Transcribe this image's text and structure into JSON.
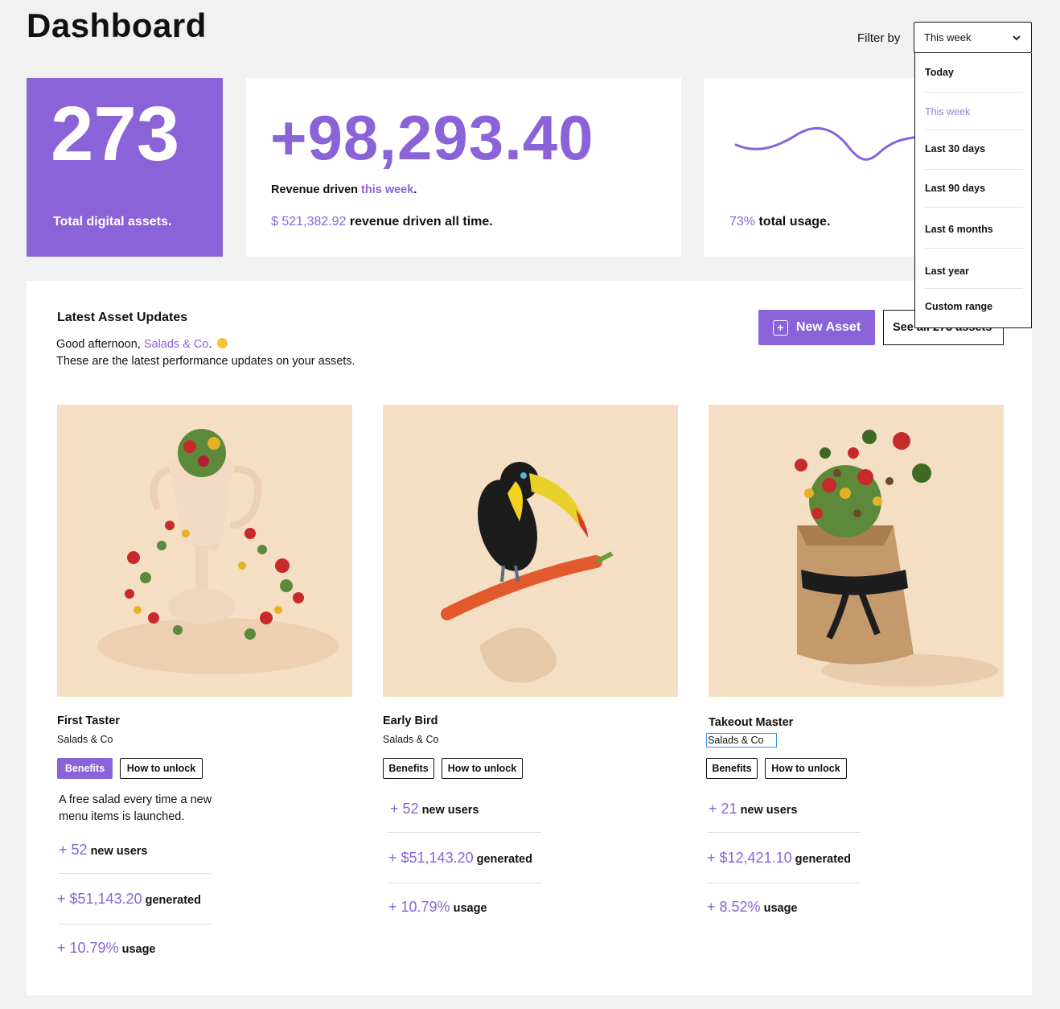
{
  "header": {
    "title": "Dashboard",
    "filter_label": "Filter by",
    "filter_value": "This week"
  },
  "filter_options": [
    "Today",
    "This week",
    "Last 30 days",
    "Last 90 days",
    "Last 6 months",
    "Last year",
    "Custom range"
  ],
  "stats": {
    "assets_count": "273",
    "assets_label": "Total digital assets.",
    "revenue_value": "+98,293.40",
    "revenue_line_prefix": "Revenue driven ",
    "revenue_line_highlight": "this week",
    "revenue_line_suffix": ".",
    "revenue_all_amount": "$ 521,382.92",
    "revenue_all_label": " revenue driven all time.",
    "usage_percent": "73%",
    "usage_label": " total usage."
  },
  "panel": {
    "title": "Latest Asset Updates",
    "greeting_prefix": "Good afternoon, ",
    "greeting_name": "Salads & Co",
    "greeting_suffix": ".",
    "subtext": "These are the latest performance updates on your assets.",
    "new_asset_label": "New Asset",
    "see_all_label": "See all 273 assets"
  },
  "assets": [
    {
      "name": "First Taster",
      "brand": "Salads & Co",
      "benefits_label": "Benefits",
      "unlock_label": "How to unlock",
      "description": "A free salad every time a new menu items is launched.",
      "users_num": "+ 52",
      "users_label": " new users",
      "generated_num": "+ $51,143.20",
      "generated_label": " generated",
      "usage_num": "+ 10.79%",
      "usage_label": " usage"
    },
    {
      "name": "Early Bird",
      "brand": "Salads & Co",
      "benefits_label": "Benefits",
      "unlock_label": "How to unlock",
      "users_num": "+ 52",
      "users_label": " new users",
      "generated_num": "+ $51,143.20",
      "generated_label": " generated",
      "usage_num": "+ 10.79%",
      "usage_label": " usage"
    },
    {
      "name": "Takeout Master",
      "brand": "Salads & Co",
      "benefits_label": "Benefits",
      "unlock_label": "How to unlock",
      "users_num": "+ 21",
      "users_label": " new users",
      "generated_num": "+ $12,421.10",
      "generated_label": " generated",
      "usage_num": "+ 8.52%",
      "usage_label": " usage"
    }
  ],
  "colors": {
    "accent": "#8a63d9",
    "page_bg": "#f1f1f1",
    "image_bg": "#f4dfc5",
    "selection": "#3b95e8"
  }
}
